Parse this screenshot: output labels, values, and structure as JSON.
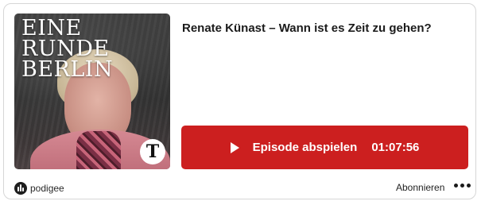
{
  "cover": {
    "title": "EINE RUNDE BERLIN",
    "badge": "T",
    "icon": "podcast-cover-image"
  },
  "episode": {
    "title": "Renate Künast – Wann ist es Zeit zu gehen?"
  },
  "player": {
    "play_label": "Episode abspielen",
    "duration": "01:07:56",
    "accent_color": "#cc1f1f"
  },
  "footer": {
    "brand": "podigee",
    "subscribe_label": "Abonnieren",
    "more_icon": "more-dots-icon"
  }
}
